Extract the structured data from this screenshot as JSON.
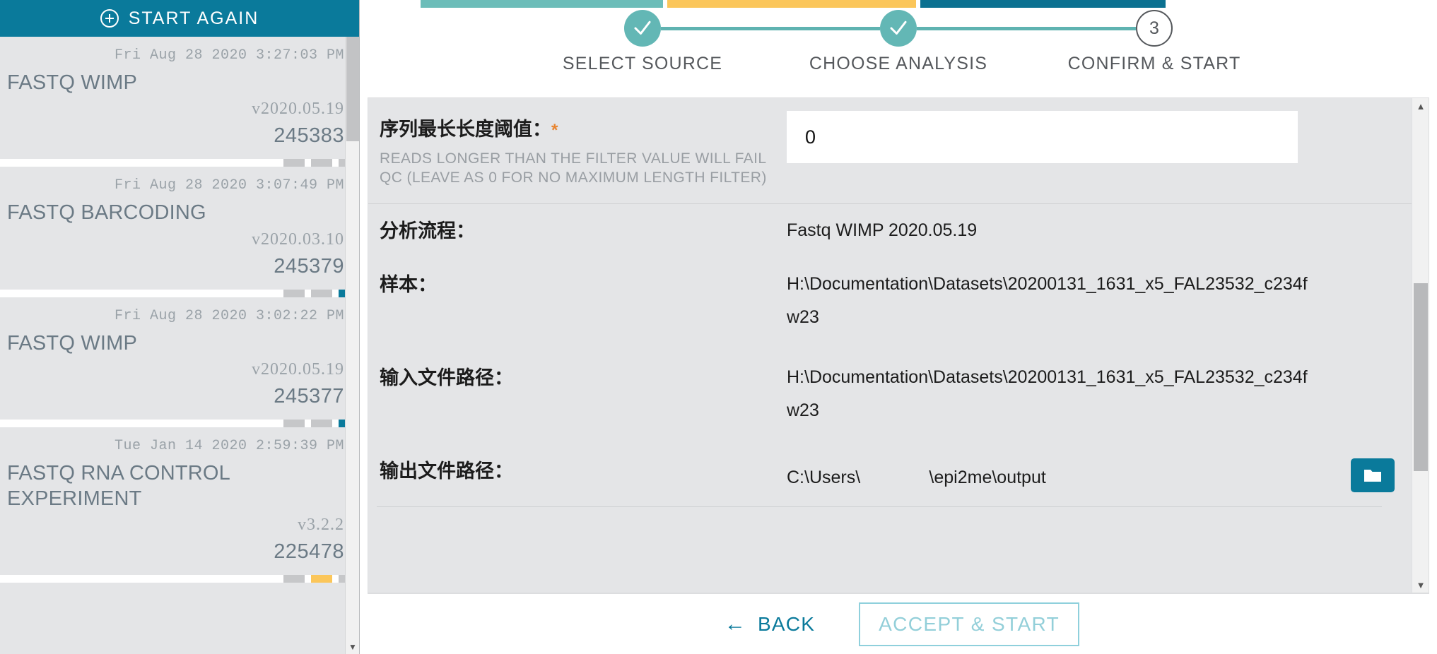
{
  "sidebar": {
    "start_again_label": "START AGAIN",
    "start_again_icon": "plus-circle-icon",
    "runs": [
      {
        "date": "Fri Aug 28 2020 3:27:03 PM",
        "title": "FASTQ WIMP",
        "version": "v2020.05.19",
        "id": "245383",
        "chips": [
          "#c6c7c9",
          "#c6c7c9",
          "#c6c7c9"
        ]
      },
      {
        "date": "Fri Aug 28 2020 3:07:49 PM",
        "title": "FASTQ BARCODING",
        "version": "v2020.03.10",
        "id": "245379",
        "chips": [
          "#c6c7c9",
          "#c6c7c9",
          "#0a7a9b"
        ]
      },
      {
        "date": "Fri Aug 28 2020 3:02:22 PM",
        "title": "FASTQ WIMP",
        "version": "v2020.05.19",
        "id": "245377",
        "chips": [
          "#c6c7c9",
          "#c6c7c9",
          "#0a7a9b"
        ]
      },
      {
        "date": "Tue Jan 14 2020 2:59:39 PM",
        "title": "FASTQ RNA CONTROL EXPERIMENT",
        "version": "v3.2.2",
        "id": "225478",
        "chips": [
          "#c6c7c9",
          "#fbc65a",
          "#c6c7c9"
        ]
      }
    ],
    "scrollbar": {
      "up_arrow": "▲",
      "down_arrow": "▼"
    }
  },
  "top_tabs": [
    {
      "name": "tab-select-source",
      "color": "#6cbdb9"
    },
    {
      "name": "tab-choose-analysis",
      "color": "#fbc65a"
    },
    {
      "name": "tab-confirm-start",
      "color": "#0b7191"
    }
  ],
  "stepper": {
    "steps": [
      {
        "label": "SELECT SOURCE",
        "state": "done",
        "marker": "✓"
      },
      {
        "label": "CHOOSE ANALYSIS",
        "state": "done",
        "marker": "✓"
      },
      {
        "label": "CONFIRM & START",
        "state": "current",
        "marker": "3"
      }
    ]
  },
  "form": {
    "max_length": {
      "label": "序列最长长度阈值：",
      "required_marker": "*",
      "help": "READS LONGER THAN THE FILTER VALUE WILL FAIL QC (LEAVE AS 0 FOR NO MAXIMUM LENGTH FILTER)",
      "value": "0",
      "placeholder": "0"
    }
  },
  "summary": {
    "rows": [
      {
        "label": "分析流程：",
        "value": "Fastq WIMP 2020.05.19"
      },
      {
        "label": "样本：",
        "value": "H:\\Documentation\\Datasets\\20200131_1631_x5_FAL23532_c234fw23"
      },
      {
        "label": "输入文件路径：",
        "value": "H:\\Documentation\\Datasets\\20200131_1631_x5_FAL23532_c234fw23"
      }
    ],
    "output_path": {
      "label": "输出文件路径：",
      "value": "C:\\Users\\              \\epi2me\\output",
      "browse_icon": "folder-icon"
    }
  },
  "panel_scrollbar": {
    "up_arrow": "▲",
    "down_arrow": "▼"
  },
  "footer": {
    "back_label": "BACK",
    "back_icon": "arrow-left-icon",
    "accept_label": "ACCEPT & START"
  },
  "colors": {
    "teal_primary": "#0a7a9b",
    "teal_light": "#63b7b5",
    "amber": "#fbc65a",
    "panel_bg": "#e4e5e7",
    "accent_orange": "#e8832d"
  }
}
